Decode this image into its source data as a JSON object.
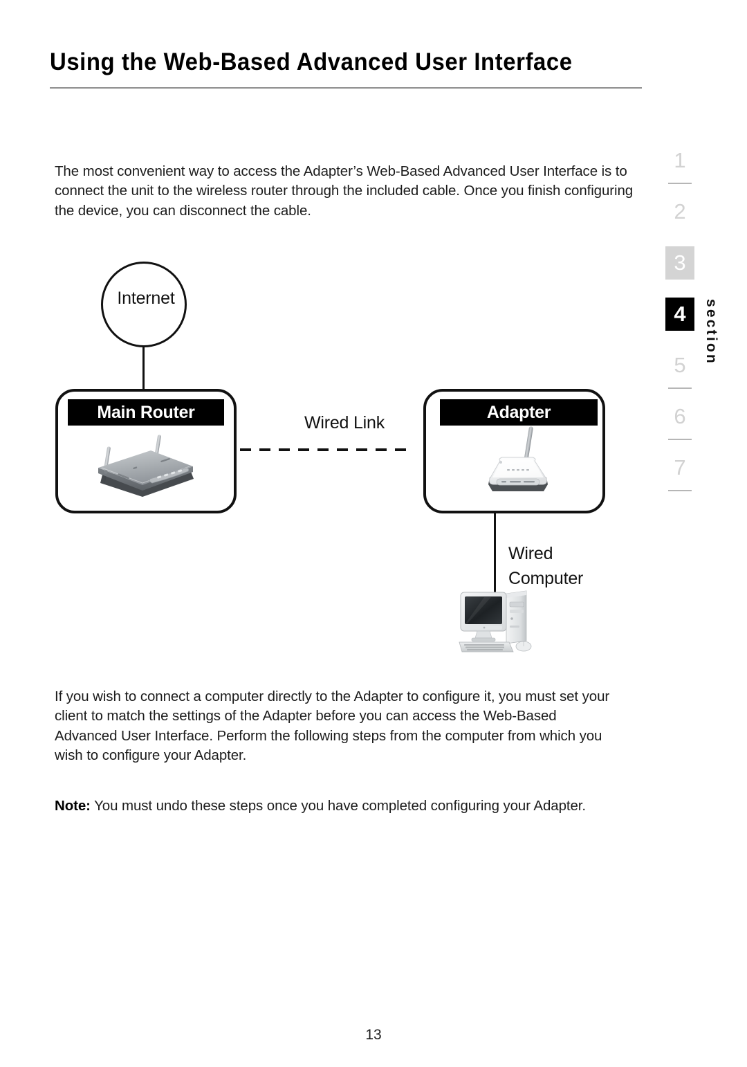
{
  "header": {
    "title": "Using the Web-Based Advanced User Interface"
  },
  "body": {
    "intro_paragraph": "The most convenient way to access the Adapter’s Web-Based Advanced User Interface is to connect the unit to the wireless router through the included cable. Once you finish configuring the device, you can disconnect the cable.",
    "detail_paragraph": "If you wish to connect a computer directly to the Adapter to configure it, you must set your client to match the settings of the Adapter before you can access the Web-Based Advanced User Interface. Perform the following steps from the computer from which you wish to configure your Adapter.",
    "note_label": "Note:",
    "note_text": " You must undo these steps once you have completed configuring your Adapter."
  },
  "diagram": {
    "internet_label": "Internet",
    "router_title": "Main Router",
    "adapter_title": "Adapter",
    "wired_link_label": "Wired Link",
    "wired_computer_label_line1": "Wired",
    "wired_computer_label_line2": "Computer",
    "icons": {
      "router": "wireless-router-icon",
      "adapter": "wireless-adapter-icon",
      "computer": "desktop-computer-icon"
    }
  },
  "section_rail": {
    "word": "section",
    "active": "4",
    "items": [
      {
        "num": "1",
        "state": "inactive"
      },
      {
        "num": "2",
        "state": "inactive"
      },
      {
        "num": "3",
        "state": "boxed-gray"
      },
      {
        "num": "4",
        "state": "boxed-black"
      },
      {
        "num": "5",
        "state": "inactive"
      },
      {
        "num": "6",
        "state": "inactive"
      },
      {
        "num": "7",
        "state": "inactive"
      }
    ]
  },
  "footer": {
    "page_number": "13"
  },
  "colors": {
    "rule": "#8e8e8e",
    "rail_inactive": "#d2d2d2",
    "rail_gray_box": "#d4d4d4",
    "rail_black_box": "#000000",
    "ink": "#1c1c1c"
  }
}
